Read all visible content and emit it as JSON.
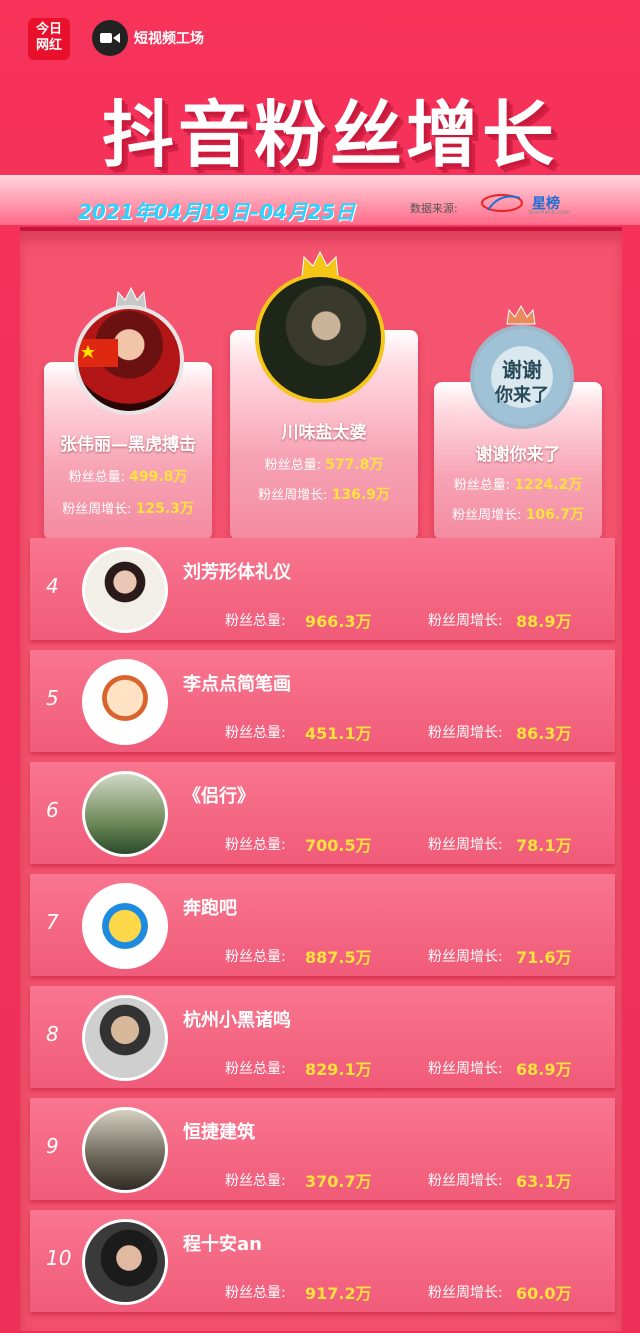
{
  "header": {
    "logo_left": "今日网红",
    "logo_right": "短视频工场",
    "title": "抖音粉丝增长",
    "date_range": "2021年04月19日–04月25日",
    "source_label": "数据来源:",
    "source_name": "星榜",
    "source_sub": "StarRank.com"
  },
  "labels": {
    "total": "粉丝总量:",
    "weekly": "粉丝周增长:"
  },
  "podium": [
    {
      "rank": 2,
      "name": "张伟丽—黑虎搏击",
      "total": "499.8万",
      "weekly": "125.3万",
      "avatar": "fighter-avatar",
      "crown": "silver"
    },
    {
      "rank": 1,
      "name": "川味盐太婆",
      "total": "577.8万",
      "weekly": "136.9万",
      "avatar": "grandma-avatar",
      "crown": "gold"
    },
    {
      "rank": 3,
      "name": "谢谢你来了",
      "total": "1224.2万",
      "weekly": "106.7万",
      "avatar": "show-logo-avatar",
      "crown": "bronze"
    }
  ],
  "rows": [
    {
      "rank": "4",
      "name": "刘芳形体礼仪",
      "total": "966.3万",
      "weekly": "88.9万"
    },
    {
      "rank": "5",
      "name": "李点点简笔画",
      "total": "451.1万",
      "weekly": "86.3万"
    },
    {
      "rank": "6",
      "name": "《侣行》",
      "total": "700.5万",
      "weekly": "78.1万"
    },
    {
      "rank": "7",
      "name": "奔跑吧",
      "total": "887.5万",
      "weekly": "71.6万"
    },
    {
      "rank": "8",
      "name": "杭州小黑诸鸣",
      "total": "829.1万",
      "weekly": "68.9万"
    },
    {
      "rank": "9",
      "name": "恒捷建筑",
      "total": "370.7万",
      "weekly": "63.1万"
    },
    {
      "rank": "10",
      "name": "程十安an",
      "total": "917.2万",
      "weekly": "60.0万"
    }
  ],
  "colors": {
    "background": "#f0305a",
    "value_yellow": "#ffe23b",
    "date_cyan": "#2bd3ff",
    "gold_crown": "#f5c518",
    "silver_crown": "#c8c8c8",
    "bronze_crown": "#e88a5a"
  }
}
